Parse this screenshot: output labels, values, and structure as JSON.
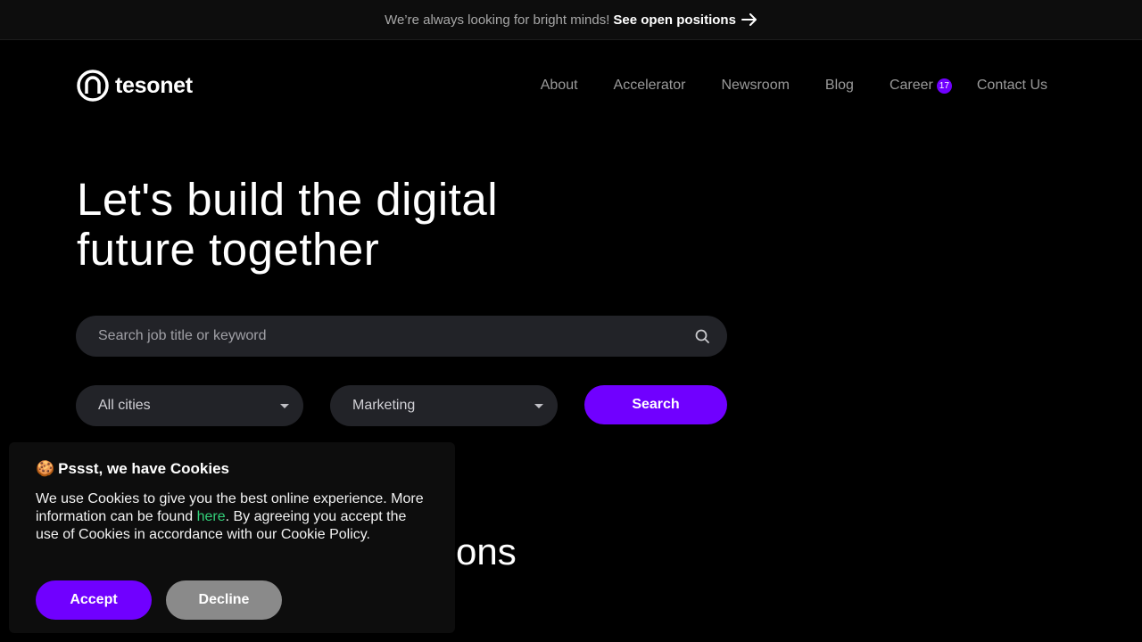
{
  "topbar": {
    "message": "We’re always looking for bright minds!",
    "link_label": "See open positions",
    "link_icon": "arrow-right-icon"
  },
  "header": {
    "logo_text": "tesonet",
    "nav": {
      "about": "About",
      "accelerator": "Accelerator",
      "newsroom": "Newsroom",
      "blog": "Blog",
      "career": "Career",
      "career_badge": "17",
      "contact": "Contact Us"
    }
  },
  "hero": {
    "title_line1": "Let's build the digital",
    "title_line2": "future together"
  },
  "search": {
    "placeholder": "Search job title or keyword",
    "value": "",
    "city_select": "All cities",
    "category_select": "Marketing",
    "button_label": "Search"
  },
  "section": {
    "title_visible": "tions"
  },
  "cookie_banner": {
    "emoji": "🍪",
    "title": "Pssst, we have Cookies",
    "text_before_link": "We use Cookies to give you the best online experience. More information can be found ",
    "link_label": "here",
    "text_after_link": ". By agreeing you accept the use of Cookies in accordance with our Cookie Policy.",
    "accept_label": "Accept",
    "decline_label": "Decline"
  },
  "colors": {
    "accent": "#7000ff",
    "link_green": "#33d17a",
    "background": "#000000",
    "input_bg": "#222328"
  }
}
